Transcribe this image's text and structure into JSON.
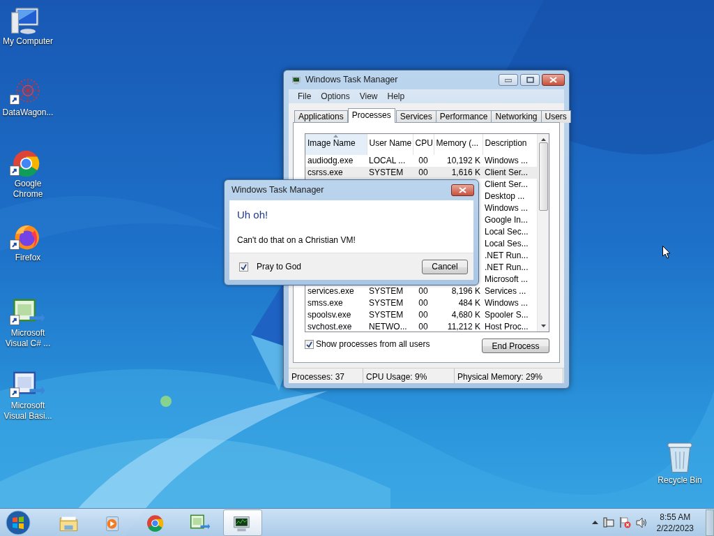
{
  "desktop_icons": [
    {
      "label": "My Computer",
      "kind": "computer"
    },
    {
      "label": "DataWagon...",
      "kind": "mesh"
    },
    {
      "label": "Google Chrome",
      "kind": "chrome"
    },
    {
      "label": "Firefox",
      "kind": "firefox"
    },
    {
      "label": "Microsoft Visual C# ...",
      "kind": "csharp"
    },
    {
      "label": "Microsoft Visual Basi...",
      "kind": "vb"
    },
    {
      "label": "Recycle Bin",
      "kind": "recycle"
    }
  ],
  "task_manager": {
    "title": "Windows Task Manager",
    "menu": [
      "File",
      "Options",
      "View",
      "Help"
    ],
    "tabs": [
      {
        "label": "Applications",
        "selected": false
      },
      {
        "label": "Processes",
        "selected": true
      },
      {
        "label": "Services",
        "selected": false
      },
      {
        "label": "Performance",
        "selected": false
      },
      {
        "label": "Networking",
        "selected": false
      },
      {
        "label": "Users",
        "selected": false
      }
    ],
    "columns": [
      "Image Name",
      "User Name",
      "CPU",
      "Memory (...",
      "Description"
    ],
    "rows": [
      {
        "image_name": "audiodg.exe",
        "user_name": "LOCAL ...",
        "cpu": "00",
        "memory": "10,192 K",
        "description": "Windows ..."
      },
      {
        "image_name": "csrss.exe",
        "user_name": "SYSTEM",
        "cpu": "00",
        "memory": "1,616 K",
        "description": "Client Ser...",
        "selected": true
      },
      {
        "description": "Client Ser..."
      },
      {
        "description": "Desktop ..."
      },
      {
        "description": "Windows ..."
      },
      {
        "description": "Google In..."
      },
      {
        "description": "Local Sec..."
      },
      {
        "description": "Local Ses..."
      },
      {
        "description": ".NET Run..."
      },
      {
        "description": ".NET Run..."
      },
      {
        "description": "Microsoft ..."
      },
      {
        "image_name": "services.exe",
        "user_name": "SYSTEM",
        "cpu": "00",
        "memory": "8,196 K",
        "description": "Services ..."
      },
      {
        "image_name": "smss.exe",
        "user_name": "SYSTEM",
        "cpu": "00",
        "memory": "484 K",
        "description": "Windows ..."
      },
      {
        "image_name": "spoolsv.exe",
        "user_name": "SYSTEM",
        "cpu": "00",
        "memory": "4,680 K",
        "description": "Spooler S..."
      },
      {
        "image_name": "svchost.exe",
        "user_name": "NETWO...",
        "cpu": "00",
        "memory": "11,212 K",
        "description": "Host Proc..."
      }
    ],
    "show_all": {
      "label": "Show processes from all users",
      "checked": true
    },
    "end_button": "End Process",
    "status": [
      "Processes: 37",
      "CPU Usage: 9%",
      "Physical Memory: 29%"
    ]
  },
  "dialog": {
    "title": "Windows Task Manager",
    "heading": "Uh oh!",
    "message": "Can't do that on a Christian VM!",
    "checkbox": {
      "label": "Pray to God",
      "checked": true
    },
    "button": "Cancel"
  },
  "taskbar": {
    "apps": [
      {
        "kind": "explorer",
        "selected": false
      },
      {
        "kind": "media",
        "selected": false
      },
      {
        "kind": "chrome",
        "selected": false
      },
      {
        "kind": "csharp",
        "selected": false
      },
      {
        "kind": "taskmgr",
        "selected": true
      }
    ]
  },
  "clock": {
    "time": "8:55 AM",
    "date": "2/22/2023"
  }
}
